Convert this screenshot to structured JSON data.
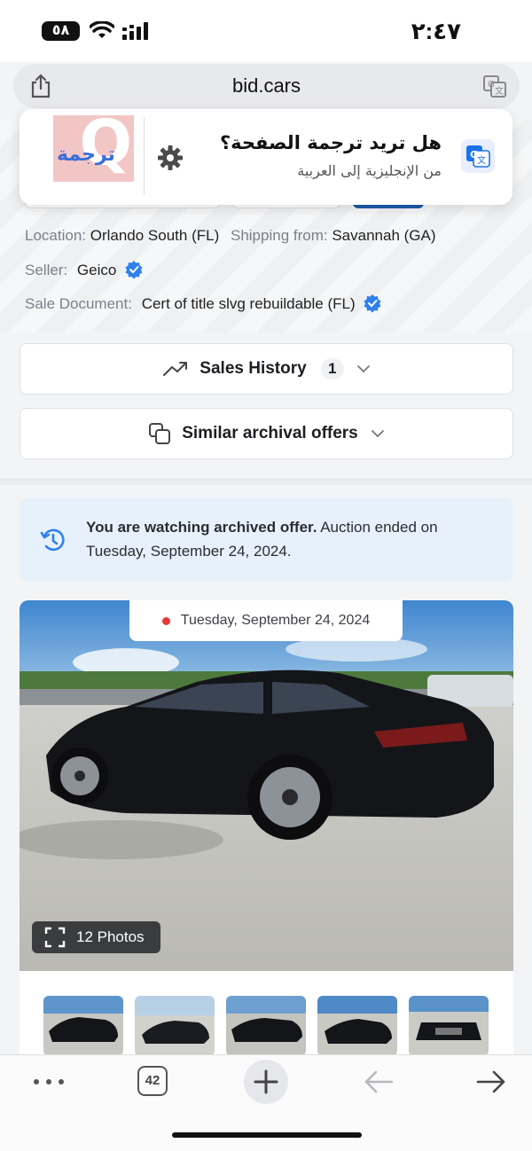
{
  "status_bar": {
    "time": "٢:٤٧",
    "battery": "٥٨"
  },
  "browser": {
    "url": "bid.cars",
    "open_tabs": "42"
  },
  "translate_popup": {
    "question": "هل تريد ترجمة الصفحة؟",
    "subtitle": "من الإنجليزية إلى العربية",
    "logo_text": "ترجمة",
    "logo_letter": "Q"
  },
  "lot_info": {
    "location_label": "Location:",
    "location_value": "Orlando South (FL)",
    "shipping_label": "Shipping from:",
    "shipping_value": "Savannah (GA)",
    "seller_label": "Seller:",
    "seller_value": "Geico",
    "sale_doc_label": "Sale Document:",
    "sale_doc_value": "Cert of title slvg rebuildable (FL)"
  },
  "accordions": {
    "sales_history": {
      "label": "Sales History",
      "count": "1"
    },
    "similar_offers": {
      "label": "Similar archival offers"
    }
  },
  "notice": {
    "bold": "You are watching archived offer.",
    "rest": " Auction ended on Tuesday, September 24, 2024."
  },
  "gallery": {
    "date": "Tuesday, September 24, 2024",
    "photos_label": "12 Photos"
  },
  "colors": {
    "accent": "#1c5aa8",
    "verified": "#2f80ed",
    "notice_bg": "#e7f1fb",
    "status_dot": "#e53935"
  }
}
